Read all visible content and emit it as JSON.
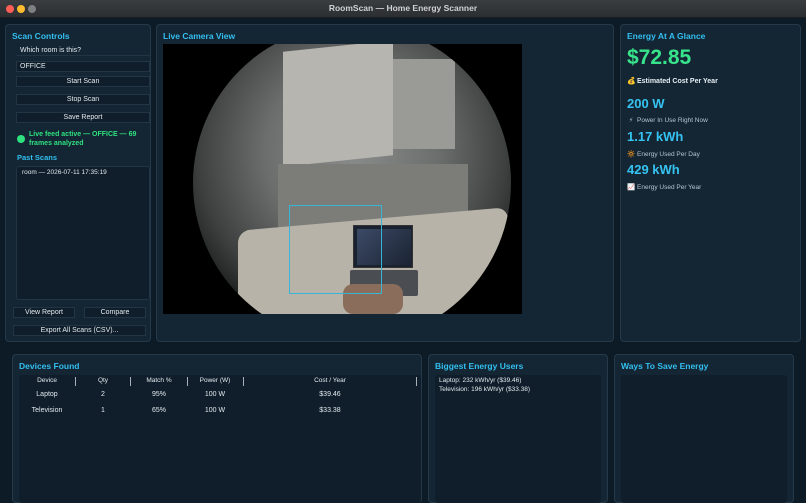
{
  "window": {
    "title": "RoomScan — Home Energy Scanner"
  },
  "scan_controls": {
    "title": "Scan Controls",
    "room_prompt": "Which room is this?",
    "room_value": "OFFICE",
    "start_label": "Start Scan",
    "stop_label": "Stop Scan",
    "save_label": "Save Report",
    "status": "Live feed active — OFFICE — 69 frames analyzed",
    "status_color": "#2fe07f",
    "past_title": "Past Scans",
    "past_scans": [
      "room — 2026-07-11 17:35:19"
    ],
    "view_label": "View Report",
    "compare_label": "Compare",
    "export_label": "Export All Scans (CSV)..."
  },
  "camera": {
    "title": "Live Camera View"
  },
  "glance": {
    "title": "Energy At A Glance",
    "cost": "$72.85",
    "cost_label": "Estimated Cost Per Year",
    "cost_icon": "💰",
    "power": "200 W",
    "power_label": "Power In Use Right Now",
    "power_icon": "⚡",
    "day": "1.17 kWh",
    "day_label": "Energy Used Per Day",
    "day_icon": "🔆",
    "year": "429 kWh",
    "year_label": "Energy Used Per Year",
    "year_icon": "📈",
    "accent": "#35c4f2",
    "cost_color": "#37e38b"
  },
  "devices": {
    "title": "Devices Found",
    "columns": [
      "Device",
      "Qty",
      "Match %",
      "Power (W)",
      "Cost / Year"
    ],
    "rows": [
      [
        "Laptop",
        "2",
        "95%",
        "100 W",
        "$39.46"
      ],
      [
        "Television",
        "1",
        "65%",
        "100 W",
        "$33.38"
      ]
    ]
  },
  "biggest": {
    "title": "Biggest Energy Users",
    "lines": [
      "Laptop: 232 kWh/yr ($39.46)",
      "Television: 196 kWh/yr ($33.38)"
    ]
  },
  "ways": {
    "title": "Ways To Save Energy"
  }
}
